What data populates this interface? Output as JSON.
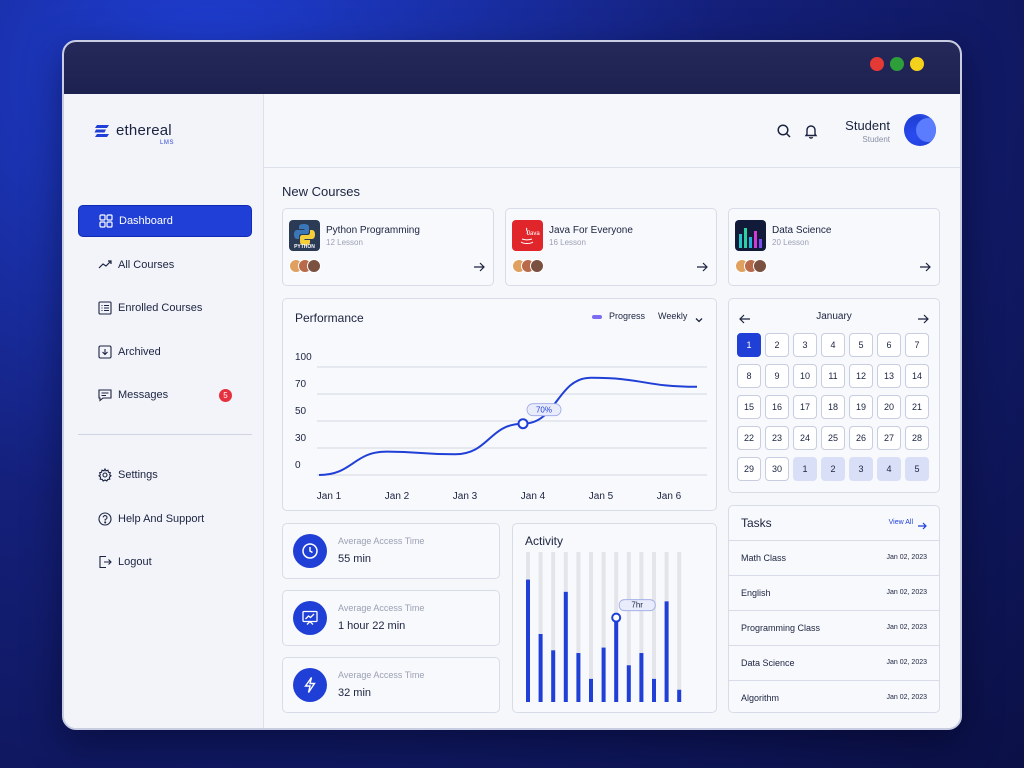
{
  "brand": {
    "name": "ethereal",
    "sub": "LMS",
    "accent": "#1f3fd6"
  },
  "sidebar": {
    "items": [
      {
        "label": "Dashboard",
        "icon": "grid-icon",
        "active": true
      },
      {
        "label": "All Courses",
        "icon": "trending-up-icon"
      },
      {
        "label": "Enrolled Courses",
        "icon": "list-icon"
      },
      {
        "label": "Archived",
        "icon": "archive-icon"
      },
      {
        "label": "Messages",
        "icon": "message-icon",
        "badge": "5"
      }
    ],
    "bottom": [
      {
        "label": "Settings",
        "icon": "gear-icon"
      },
      {
        "label": "Help And Support",
        "icon": "help-icon"
      },
      {
        "label": "Logout",
        "icon": "logout-icon"
      }
    ]
  },
  "header": {
    "user_name": "Student",
    "user_role": "Student"
  },
  "new_courses": {
    "title": "New Courses",
    "items": [
      {
        "title": "Python Programming",
        "sub": "12 Lesson",
        "icon_label": "PYTHON"
      },
      {
        "title": "Java For Everyone",
        "sub": "16 Lesson",
        "icon_label": "Java"
      },
      {
        "title": "Data Science",
        "sub": "20 Lesson"
      }
    ]
  },
  "performance": {
    "title": "Performance",
    "legend": "Progress",
    "period": "Weekly",
    "marker_label": "70%"
  },
  "chart_data": {
    "type": "line",
    "x": [
      "Jan 1",
      "Jan 2",
      "Jan 3",
      "Jan 4",
      "Jan 5",
      "Jan 6"
    ],
    "y_ticks": [
      0,
      30,
      50,
      70,
      100
    ],
    "series": [
      {
        "values": [
          0,
          26,
          23,
          48,
          88,
          78
        ],
        "highlight_index": 3,
        "highlight_label": "70%"
      }
    ],
    "grid": true
  },
  "stats": [
    {
      "label": "Average Access Time",
      "value": "55 min",
      "icon": "clock-icon"
    },
    {
      "label": "Average Access Time",
      "value": "1 hour 22 min",
      "icon": "presentation-chart-icon"
    },
    {
      "label": "Average Access Time",
      "value": "32 min",
      "icon": "lightning-icon"
    }
  ],
  "activity": {
    "title": "Activity",
    "marker_label": "7hr",
    "bars": [
      0.9,
      0.5,
      0.38,
      0.81,
      0.36,
      0.17,
      0.4,
      0.62,
      0.27,
      0.36,
      0.17,
      0.74,
      0.09
    ]
  },
  "calendar": {
    "month": "January",
    "days": [
      "1",
      "2",
      "3",
      "4",
      "5",
      "6",
      "7",
      "8",
      "9",
      "10",
      "11",
      "12",
      "13",
      "14",
      "15",
      "16",
      "17",
      "18",
      "19",
      "20",
      "21",
      "22",
      "23",
      "24",
      "25",
      "26",
      "27",
      "28",
      "29",
      "30",
      "1",
      "2",
      "3",
      "4",
      "5"
    ],
    "selected_index": 0,
    "next_month_from_index": 30
  },
  "tasks": {
    "title": "Tasks",
    "view_all": "View All",
    "items": [
      {
        "name": "Math Class",
        "date": "Jan 02, 2023"
      },
      {
        "name": "English",
        "date": "Jan 02, 2023"
      },
      {
        "name": "Programming Class",
        "date": "Jan 02, 2023"
      },
      {
        "name": "Data Science",
        "date": "Jan 02, 2023"
      },
      {
        "name": "Algorithm",
        "date": "Jan 02, 2023"
      }
    ]
  }
}
